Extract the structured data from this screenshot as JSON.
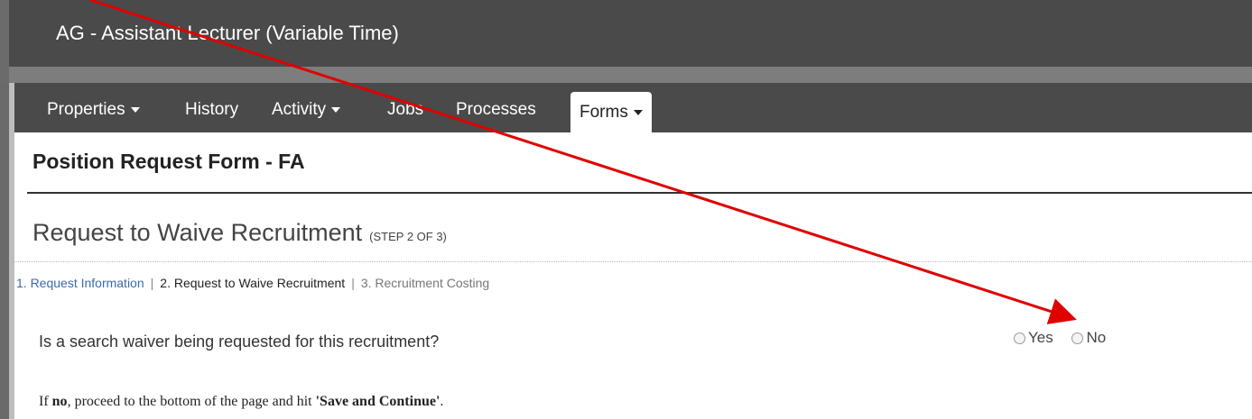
{
  "window": {
    "title": "AG - Assistant Lecturer (Variable Time)"
  },
  "nav": {
    "items": [
      {
        "label": "Properties",
        "dropdown": true
      },
      {
        "label": "History",
        "dropdown": false
      },
      {
        "label": "Activity",
        "dropdown": true
      },
      {
        "label": "Jobs",
        "dropdown": false
      },
      {
        "label": "Processes",
        "dropdown": false
      },
      {
        "label": "Forms",
        "dropdown": true,
        "active": true
      }
    ]
  },
  "form": {
    "title": "Position Request Form - FA",
    "section_title": "Request to Waive Recruitment",
    "step_label": "(STEP 2 OF 3)",
    "steps": [
      {
        "label": "1. Request Information",
        "state": "link"
      },
      {
        "label": "2. Request to Waive Recruitment",
        "state": "current"
      },
      {
        "label": "3. Recruitment Costing",
        "state": "future"
      }
    ],
    "step_separator": "|",
    "question": "Is a search waiver being requested for this recruitment?",
    "radio_options": [
      "Yes",
      "No"
    ],
    "note": {
      "prefix": "If ",
      "bold_word": "no",
      "middle": ", proceed to the bottom of the page and hit ",
      "bold_action": "'Save and Continue'",
      "suffix": "."
    }
  },
  "colors": {
    "header_bg": "#4a4a4a",
    "link": "#3c6aa8",
    "annotation_arrow": "#e00000"
  }
}
